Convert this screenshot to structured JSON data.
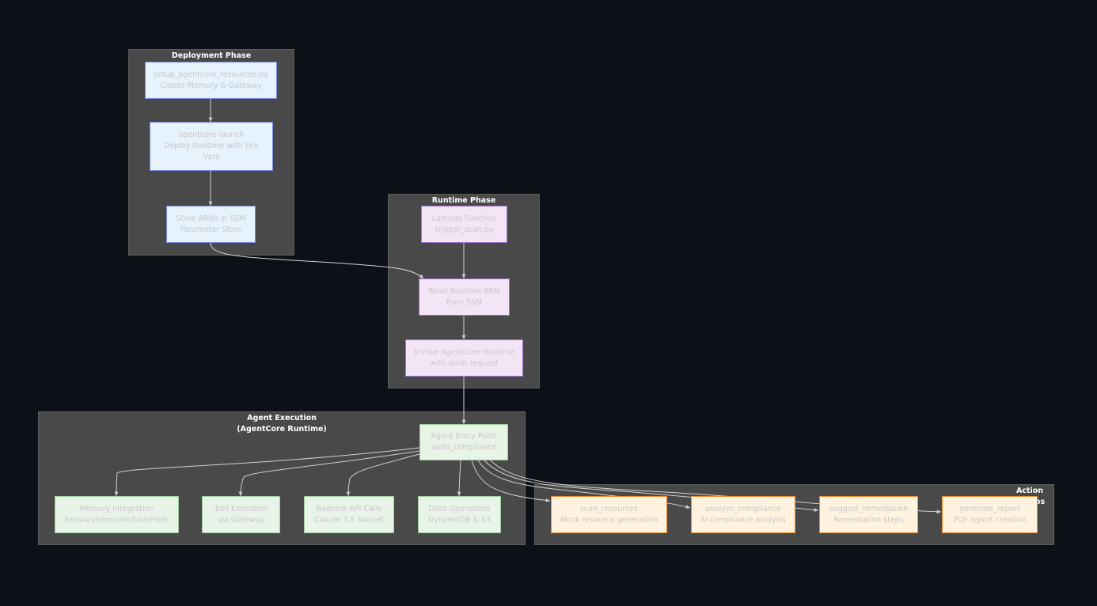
{
  "subgraphs": {
    "deployment": "Deployment Phase",
    "runtime": "Runtime Phase",
    "agent_title": "Agent Execution",
    "agent_subtitle": "(AgentCore Runtime)",
    "actions": "Action Groups"
  },
  "nodes": {
    "setup": [
      "setup_agentcore_resources.py",
      "Create Memory & Gateway"
    ],
    "launch": [
      "agentcore launch",
      "Deploy Runtime with Env",
      "Vars"
    ],
    "store": [
      "Store ARNs in SSM",
      "Parameter Store"
    ],
    "lambda": [
      "Lambda Function",
      "trigger_scan.py"
    ],
    "read": [
      "Read Runtime ARN",
      "from SSM"
    ],
    "invoke": [
      "Invoke AgentCore Runtime",
      "with audit request"
    ],
    "entry": [
      "Agent Entry Point",
      "audit_compliance"
    ],
    "memory": [
      "Memory Integration",
      "Session/Semantic/UserPrefs"
    ],
    "tool": [
      "Tool Execution",
      "via Gateway"
    ],
    "bedrock": [
      "Bedrock API Calls",
      "Claude 3.5 Sonnet"
    ],
    "data": [
      "Data Operations",
      "DynamoDB & S3"
    ],
    "scan": [
      "scan_resources",
      "Mock resource generation"
    ],
    "analyze": [
      "analyze_compliance",
      "AI compliance analysis"
    ],
    "suggest": [
      "suggest_remediation",
      "Remediation steps"
    ],
    "generate": [
      "generate_report",
      "PDF report creation"
    ]
  },
  "colors": {
    "background": "#0d1016",
    "subgraph": "#494949",
    "edge": "#d0d0d0",
    "deploy_fill": "#e6f2fc",
    "runtime_fill": "#f3e5f5",
    "agent_fill": "#e9f4e9",
    "action_fill": "#fff3e0"
  }
}
